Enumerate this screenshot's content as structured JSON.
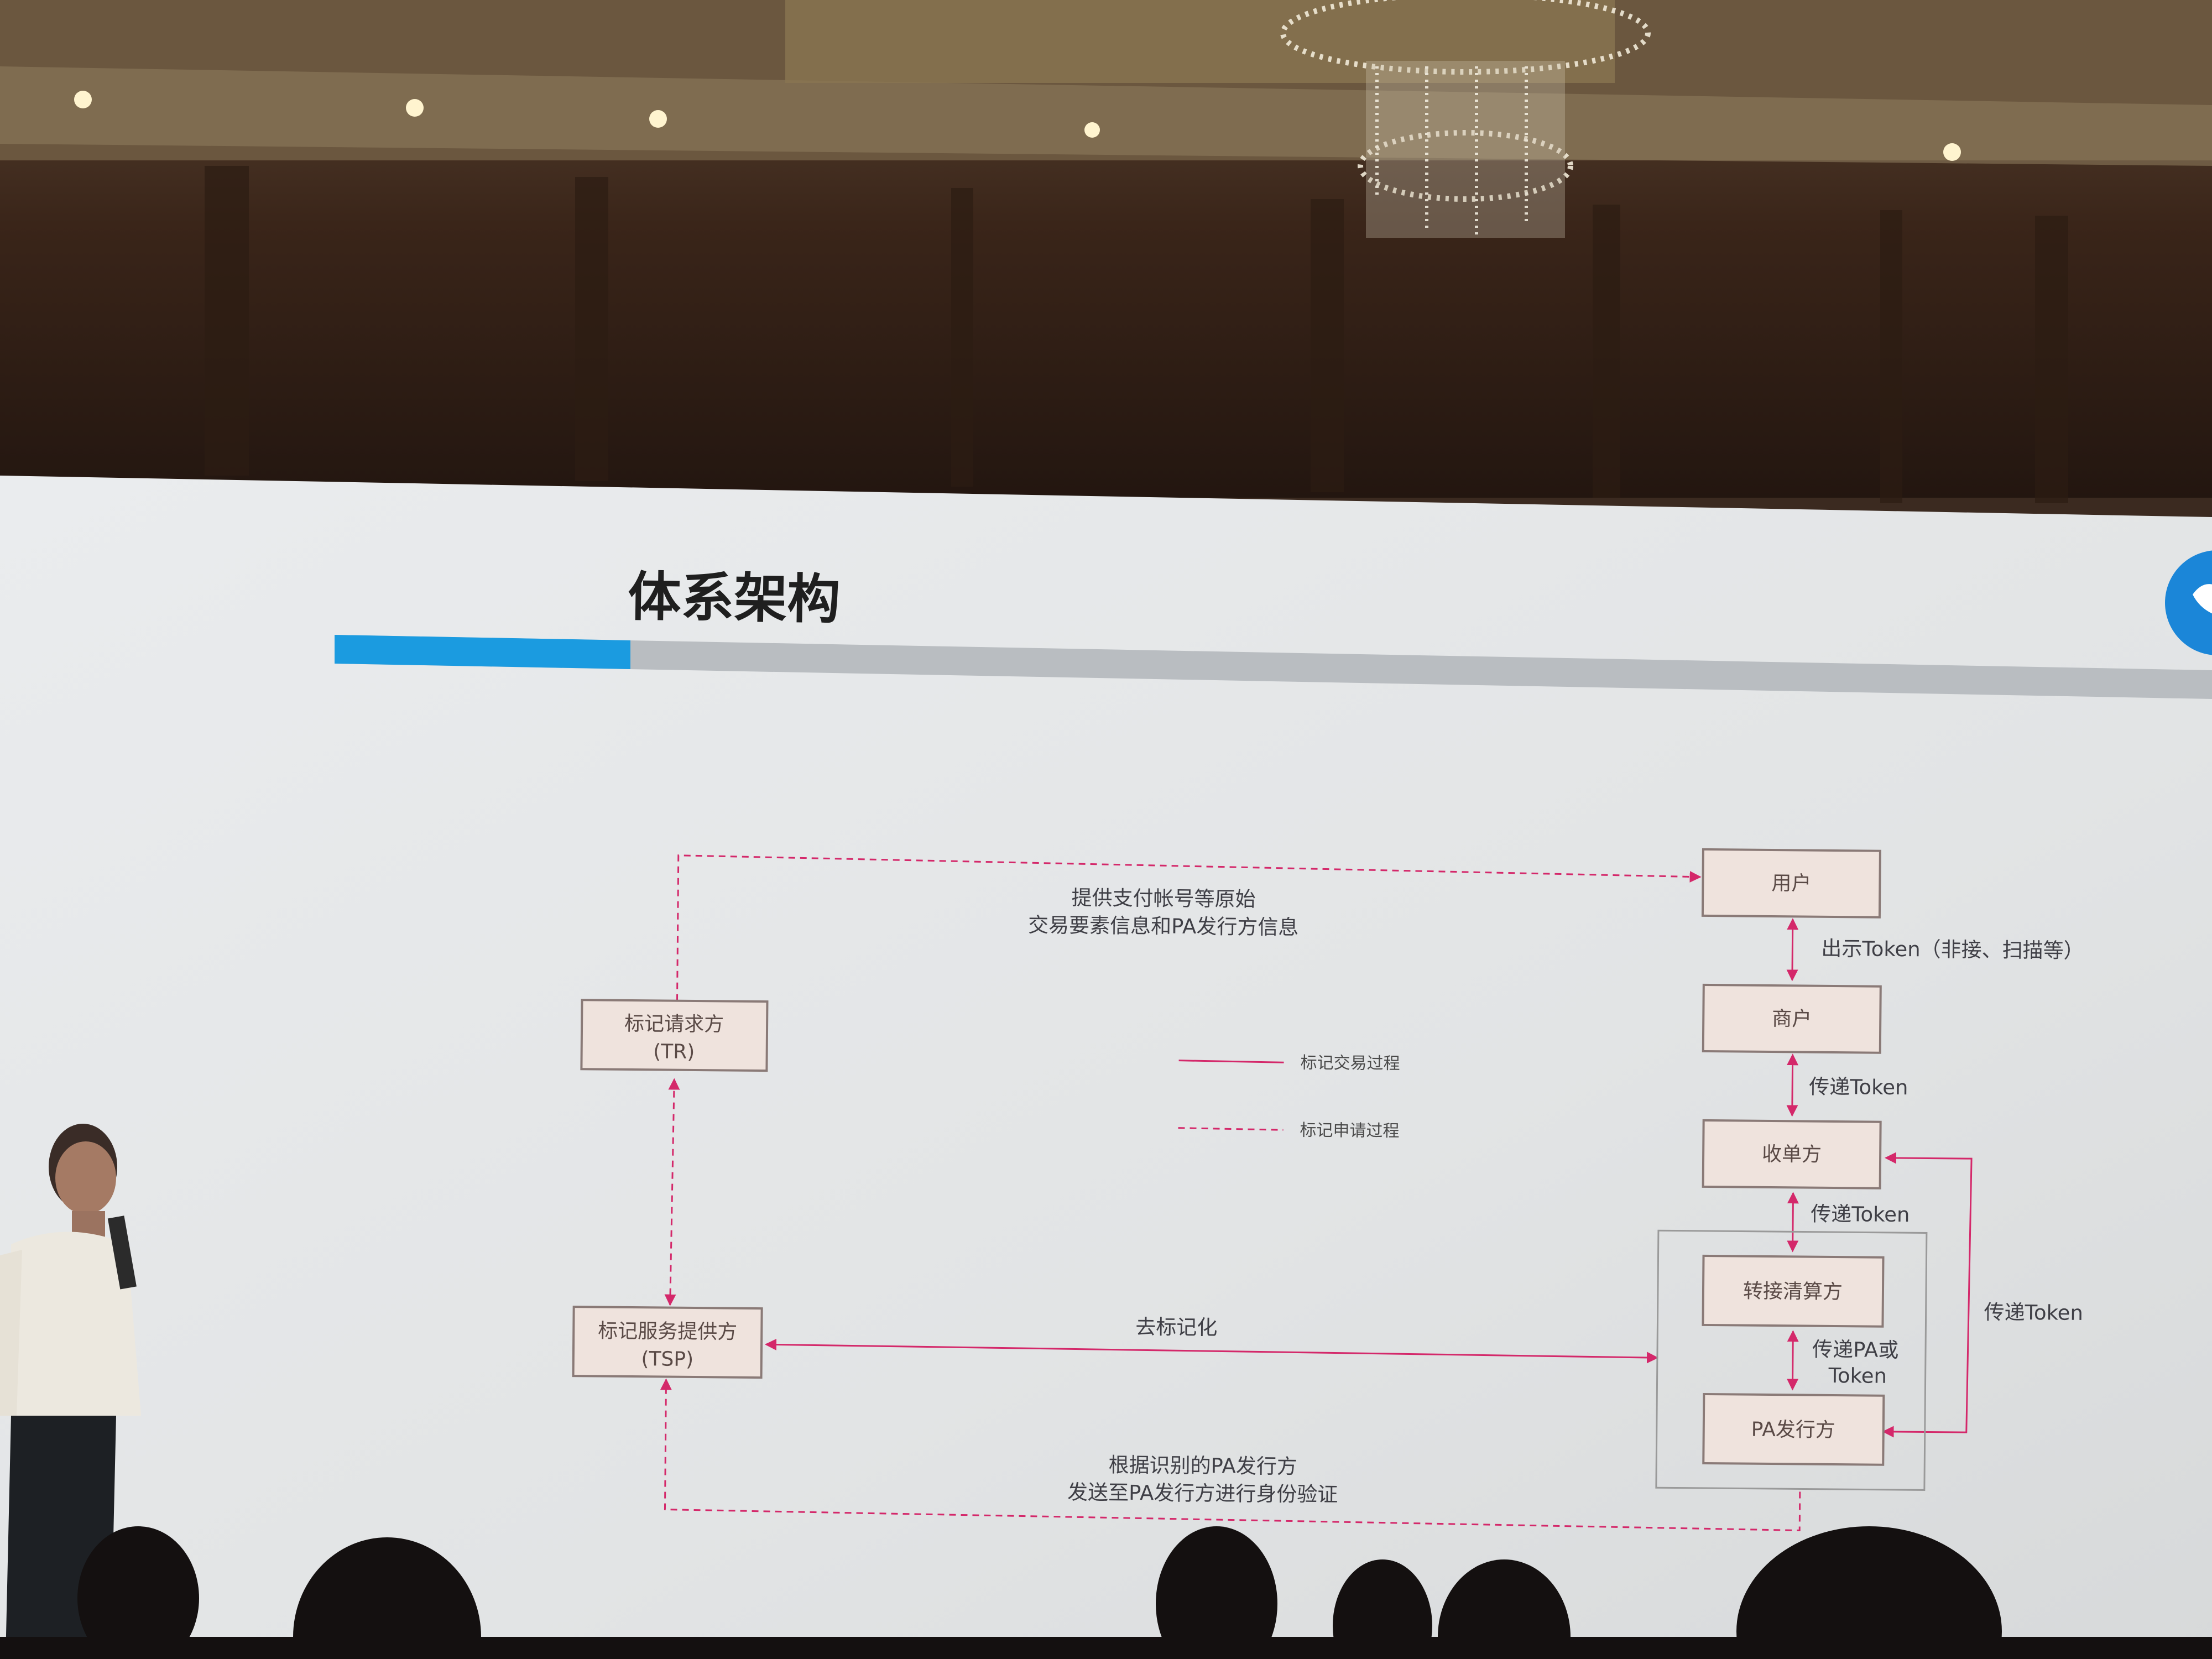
{
  "slide": {
    "title": "体系架构",
    "accent_color": "#1b9be0",
    "track_color": "#b9bdc1"
  },
  "nodes": {
    "tr_line1": "标记请求方",
    "tr_line2": "(TR)",
    "tsp_line1": "标记服务提供方",
    "tsp_line2": "(TSP)",
    "user": "用户",
    "merchant": "商户",
    "acquirer": "收单方",
    "switch": "转接清算方",
    "pa_issuer": "PA发行方"
  },
  "edges": {
    "top_line1": "提供支付帐号等原始",
    "top_line2": "交易要素信息和PA发行方信息",
    "show_token": "出示Token（非接、扫描等）",
    "pass_token_1": "传递Token",
    "pass_token_2": "传递Token",
    "pass_pa_line1": "传递PA或",
    "pass_pa_line2": "Token",
    "pass_token_right": "传递Token",
    "detokenize": "去标记化",
    "bottom_line1": "根据识别的PA发行方",
    "bottom_line2": "发送至PA发行方进行身份验证"
  },
  "legend": {
    "solid_label": "标记交易过程",
    "dashed_label": "标记申请过程"
  },
  "colors": {
    "arrow": "#d4286a",
    "box_fill": "#efe3dd",
    "box_border": "#8a7a77",
    "slide_bg": "#e3e5e6"
  }
}
